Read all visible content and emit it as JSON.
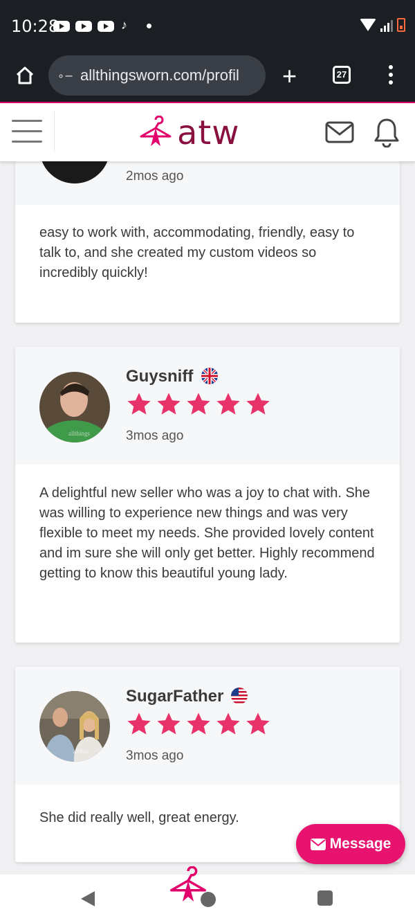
{
  "status_bar": {
    "time": "10:28"
  },
  "browser": {
    "url": "allthingsworn.com/profil",
    "tab_count": "27"
  },
  "site": {
    "logo_text": "atw",
    "brand_color": "#e2006a"
  },
  "top_review": {
    "time_ago": "2mos ago",
    "text": "easy to work with, accommodating, friendly, easy to talk to, and she created my custom videos so incredibly quickly!"
  },
  "reviews": [
    {
      "name": "Guysniff",
      "country": "GB",
      "rating": 5,
      "time_ago": "3mos ago",
      "text": "A delightful new seller who was a joy to chat with. She was willing to experience new things and was very flexible to meet my needs. She provided lovely content and im sure she will only get better. Highly recommend getting to know this beautiful young lady.",
      "avatar_watermark": "allthings"
    },
    {
      "name": "SugarFather",
      "country": "US",
      "rating": 5,
      "time_ago": "3mos ago",
      "text": "She did really well, great energy.",
      "avatar_watermark": "allthin"
    }
  ],
  "message_button": {
    "label": "Message"
  }
}
